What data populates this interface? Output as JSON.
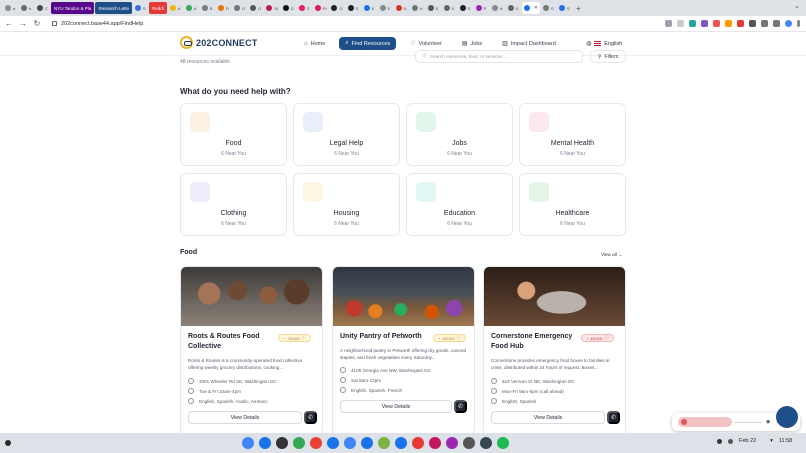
{
  "browser": {
    "tabs": [
      {
        "label": "a",
        "color": "#8a8a8a"
      },
      {
        "label": "b",
        "color": "#6a6a6a"
      },
      {
        "label": "C",
        "color": "#4a4a4a"
      },
      {
        "label": "NYU Tandon & Pla",
        "color": "#57068c",
        "pill": true
      },
      {
        "label": "Research Lette",
        "color": "#1e4f88",
        "pill": true
      },
      {
        "label": "S",
        "color": "#3a6ee8"
      },
      {
        "label": "Reddi",
        "color": "#e53935",
        "pill": true
      },
      {
        "label": "A",
        "color": "#f4b400"
      },
      {
        "label": "A",
        "color": "#34a853"
      },
      {
        "label": "B",
        "color": "#7a7a7a"
      },
      {
        "label": "Fi",
        "color": "#e8710a"
      },
      {
        "label": "G",
        "color": "#777"
      },
      {
        "label": "G",
        "color": "#555"
      },
      {
        "label": "Si",
        "color": "#c2185b"
      },
      {
        "label": "D",
        "color": "#111"
      },
      {
        "label": "Z",
        "color": "#e91e63"
      },
      {
        "label": "Pi",
        "color": "#d81b60"
      },
      {
        "label": "G",
        "color": "#222"
      },
      {
        "label": "S",
        "color": "#222"
      },
      {
        "label": "E",
        "color": "#1a73e8"
      },
      {
        "label": "E",
        "color": "#888"
      },
      {
        "label": "D",
        "color": "#d93025"
      },
      {
        "label": "H",
        "color": "#777"
      },
      {
        "label": "S",
        "color": "#555"
      },
      {
        "label": "S",
        "color": "#666"
      },
      {
        "label": "S",
        "color": "#222"
      },
      {
        "label": "P",
        "color": "#9c27b0"
      },
      {
        "label": "H",
        "color": "#888"
      },
      {
        "label": "G",
        "color": "#666"
      },
      {
        "label": "",
        "color": "#1a73e8",
        "active": true
      },
      {
        "label": "G",
        "color": "#777"
      },
      {
        "label": "S",
        "color": "#1a73e8"
      }
    ],
    "url": "202connect.base44.app/FindHelp"
  },
  "site": {
    "logo": {
      "prefix": "202",
      "suffix": "CONNECT"
    },
    "nav": [
      {
        "label": "Home",
        "icon": "⌂",
        "active": false
      },
      {
        "label": "Find Resources",
        "icon": "⌕",
        "active": true
      },
      {
        "label": "Volunteer",
        "icon": "♡",
        "active": false
      },
      {
        "label": "Jobs",
        "icon": "▤",
        "active": false
      },
      {
        "label": "Impact Dashboard",
        "icon": "▥",
        "active": false
      }
    ],
    "language": "English"
  },
  "search": {
    "count_text": "48 resources available",
    "placeholder": "Search resources, food, or services...",
    "filters_label": "Filters"
  },
  "categories_section": {
    "title": "What do you need help with?",
    "items": [
      {
        "name": "Food",
        "count": "6 Near You",
        "color": "#fdf0e4"
      },
      {
        "name": "Legal Help",
        "count": "6 Near You",
        "color": "#e9eefb"
      },
      {
        "name": "Jobs",
        "count": "6 Near You",
        "color": "#e3f6ec"
      },
      {
        "name": "Mental Health",
        "count": "6 Near You",
        "color": "#fce8ef"
      },
      {
        "name": "Clothing",
        "count": "6 Near You",
        "color": "#efedfb"
      },
      {
        "name": "Housing",
        "count": "6 Near You",
        "color": "#fdf6e0"
      },
      {
        "name": "Education",
        "count": "6 Near You",
        "color": "#e0f7f6"
      },
      {
        "name": "Healthcare",
        "count": "6 Near You",
        "color": "#e4f5e8"
      }
    ]
  },
  "food_section": {
    "title": "Food",
    "view_all": "View all →",
    "cards": [
      {
        "title": "Roots & Routes Food Collective",
        "badge": "75/100",
        "badge_tone": "amber",
        "description": "Roots & Routes is a community-operated food collective offering weekly grocery distributions, cooking...",
        "address": "3301 Wheeler Rd SE, Washington DC",
        "hours": "Tue & Fri 10am-4pm",
        "languages": "English, Spanish, Arabic, Amharic",
        "button": "View Details"
      },
      {
        "title": "Unity Pantry of Petworth",
        "badge": "60/100",
        "badge_tone": "amber",
        "description": "A neighborhood pantry in Petworth offering dry goods, canned staples, and fresh vegetables every Saturday...",
        "address": "4109 Georgia Ave NW, Washington DC",
        "hours": "Sat 8am-12pm",
        "languages": "English, Spanish, French",
        "button": "View Details"
      },
      {
        "title": "Cornerstone Emergency Food Hub",
        "badge": "40/100",
        "badge_tone": "red",
        "description": "Cornerstone provides emergency food boxes to families in crisis, distributed within 24 hours of request. Boxes...",
        "address": "616 Vernum St NE, Washington DC",
        "hours": "Mon-Fri 9am-5pm (call ahead)",
        "languages": "English, Spanish",
        "button": "View Details"
      }
    ]
  },
  "taskbar": {
    "date": "Feb 22",
    "time": "11:58",
    "apps": [
      "#4285f4",
      "#1a73e8",
      "#333333",
      "#34a853",
      "#ea4335",
      "#1a73e8",
      "#4285f4",
      "#1a73e8",
      "#7cb342",
      "#1a73e8",
      "#e53935",
      "#c2185b",
      "#9c27b0",
      "#555555",
      "#37474f",
      "#1db954"
    ]
  }
}
